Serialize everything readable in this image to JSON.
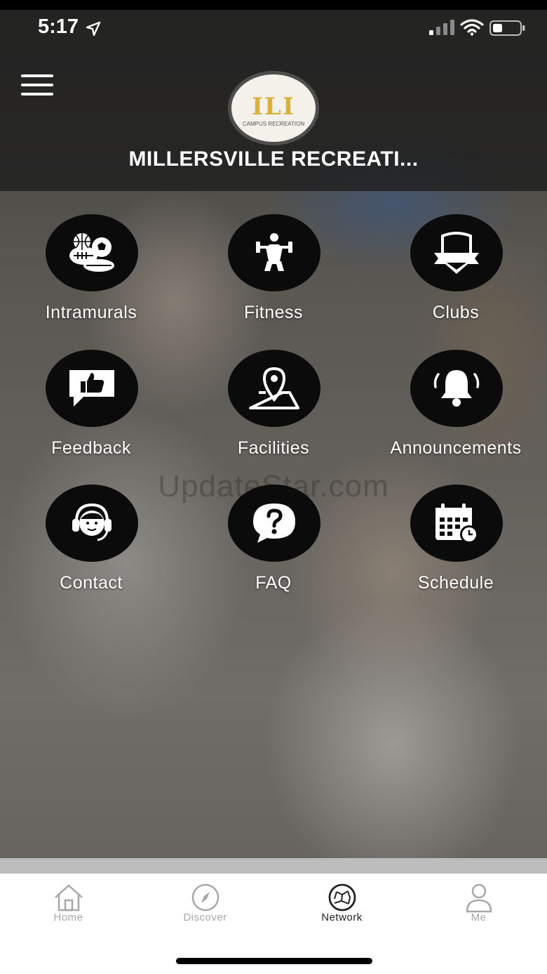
{
  "status_bar": {
    "time": "5:17"
  },
  "header": {
    "title": "MILLERSVILLE RECREATI...",
    "logo_text": "ILI",
    "logo_subtext": "CAMPUS RECREATION"
  },
  "watermark": "UpdateStar.com",
  "tiles": [
    {
      "label": "Intramurals",
      "icon": "sports-balls-icon"
    },
    {
      "label": "Fitness",
      "icon": "weightlifter-icon"
    },
    {
      "label": "Clubs",
      "icon": "badge-shield-icon"
    },
    {
      "label": "Feedback",
      "icon": "thumbs-up-chat-icon"
    },
    {
      "label": "Facilities",
      "icon": "map-pin-icon"
    },
    {
      "label": "Announcements",
      "icon": "bell-icon"
    },
    {
      "label": "Contact",
      "icon": "headset-person-icon"
    },
    {
      "label": "FAQ",
      "icon": "question-bubble-icon"
    },
    {
      "label": "Schedule",
      "icon": "calendar-clock-icon"
    }
  ],
  "tabbar": {
    "tabs": [
      {
        "label": "Home",
        "icon": "home-icon",
        "active": false
      },
      {
        "label": "Discover",
        "icon": "compass-icon",
        "active": false
      },
      {
        "label": "Network",
        "icon": "network-globe-icon",
        "active": true
      },
      {
        "label": "Me",
        "icon": "person-icon",
        "active": false
      }
    ]
  },
  "colors": {
    "header_bg": "#1e1e1e",
    "tile_circle": "#0b0b0b",
    "tab_inactive": "#a8a8a8",
    "tab_active": "#222222",
    "logo_accent": "#d6b23a"
  }
}
